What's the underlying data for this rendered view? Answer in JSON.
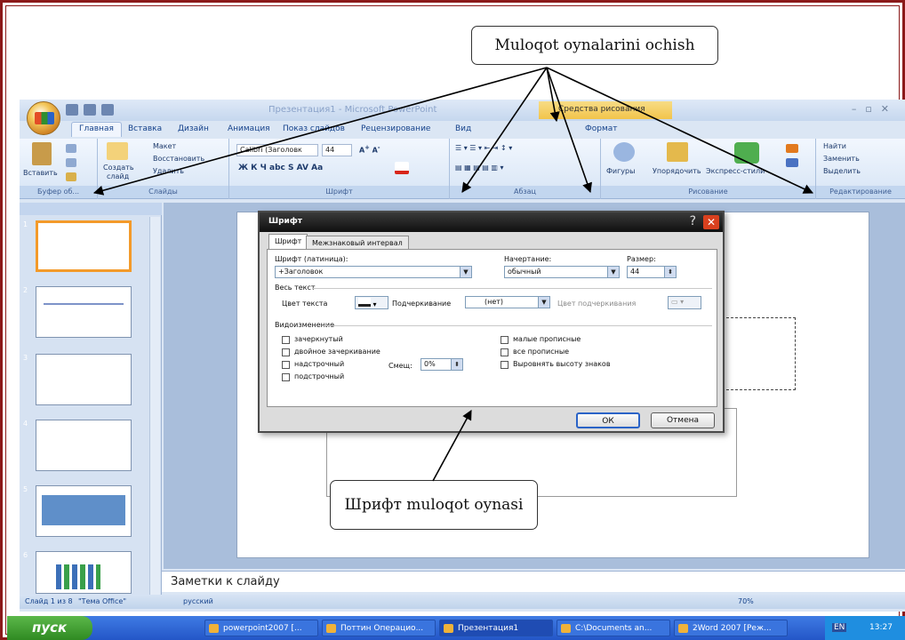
{
  "callouts": {
    "top": "Muloqot oynalarini ochish",
    "bottom": "Шрифт muloqot oynasi"
  },
  "app": {
    "window_title": "Презентация1 - Microsoft PowerPoint",
    "contextual_tool": "Средства рисования",
    "tabs": [
      "Главная",
      "Вставка",
      "Дизайн",
      "Анимация",
      "Показ слайдов",
      "Рецензирование",
      "Вид",
      "Формат"
    ],
    "ribbon": {
      "clipboard": {
        "paste": "Вставить",
        "label": "Буфер об..."
      },
      "slides": {
        "create": "Создать",
        "create2": "слайд",
        "layout": "Макет",
        "reset": "Восстановить",
        "delete": "Удалить",
        "label": "Слайды"
      },
      "font": {
        "font_name": "Calibri (Заголовк",
        "font_size": "44",
        "label": "Шрифт"
      },
      "paragraph": {
        "label": "Абзац"
      },
      "drawing": {
        "shapes": "Фигуры",
        "arrange": "Упорядочить",
        "quick_styles": "Экспресс-стили",
        "label": "Рисование"
      },
      "editing": {
        "find": "Найти",
        "replace": "Заменить",
        "select": "Выделить",
        "label": "Редактирование"
      }
    },
    "slides_pane": {
      "numbers": [
        "1",
        "2",
        "3",
        "4",
        "5",
        "6"
      ]
    },
    "notes_placeholder": "Заметки к слайду",
    "status": {
      "slide": "Слайд 1 из 8",
      "theme": "\"Тема Office\"",
      "language": "русский",
      "zoom": "70%"
    }
  },
  "dialog": {
    "title": "Шрифт",
    "help": "?",
    "tabs": [
      "Шрифт",
      "Межзнаковый интервал"
    ],
    "latin_font_label": "Шрифт (латиница):",
    "latin_font_value": "+Заголовок",
    "style_label": "Начертание:",
    "style_value": "обычный",
    "size_label": "Размер:",
    "size_value": "44",
    "all_text_label": "Весь текст",
    "font_color_label": "Цвет текста",
    "underline_label": "Подчеркивание",
    "underline_value": "(нет)",
    "underline_color_label": "Цвет подчеркивания",
    "effects_label": "Видоизменение",
    "effects_left": [
      "зачеркнутый",
      "двойное зачеркивание",
      "надстрочный",
      "подстрочный"
    ],
    "offset_label": "Смещ:",
    "offset_value": "0%",
    "effects_right": [
      "малые прописные",
      "все прописные",
      "Выровнять высоту знаков"
    ],
    "ok": "ОК",
    "cancel": "Отмена"
  },
  "taskbar": {
    "start": "пуск",
    "items": [
      "powerpoint2007 [...",
      "Поттин Операцио...",
      "Презентация1",
      "C:\\Documents an...",
      "2Word 2007 [Реж..."
    ],
    "language": "EN",
    "time": "13:27"
  }
}
